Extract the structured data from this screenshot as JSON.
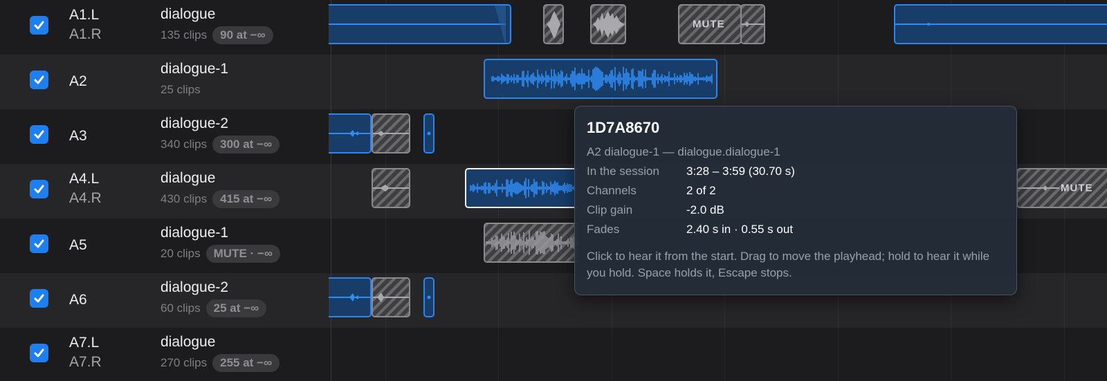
{
  "tracks": [
    {
      "channels": [
        "A1.L",
        "A1.R"
      ],
      "title": "dialogue",
      "clips": "135 clips",
      "gain": "90 at −∞"
    },
    {
      "channels": [
        "A2"
      ],
      "title": "dialogue-1",
      "clips": "25 clips",
      "gain": ""
    },
    {
      "channels": [
        "A3"
      ],
      "title": "dialogue-2",
      "clips": "340 clips",
      "gain": "300 at −∞"
    },
    {
      "channels": [
        "A4.L",
        "A4.R"
      ],
      "title": "dialogue",
      "clips": "430 clips",
      "gain": "415 at −∞"
    },
    {
      "channels": [
        "A5"
      ],
      "title": "dialogue-1",
      "clips": "20 clips",
      "gain": "MUTE · −∞"
    },
    {
      "channels": [
        "A6"
      ],
      "title": "dialogue-2",
      "clips": "60 clips",
      "gain": "25 at −∞"
    },
    {
      "channels": [
        "A7.L",
        "A7.R"
      ],
      "title": "dialogue",
      "clips": "270 clips",
      "gain": "255 at −∞"
    }
  ],
  "mute_label": "MUTE",
  "mute_label_truncated": "MUTE",
  "tooltip": {
    "title": "1D7A8670",
    "subtitle": "A2 dialogue-1  —  dialogue.dialogue-1",
    "rows": [
      {
        "label": "In the session",
        "value": "3:28 – 3:59  (30.70 s)"
      },
      {
        "label": "Channels",
        "value": "2 of 2"
      },
      {
        "label": "Clip gain",
        "value": "-2.0 dB"
      },
      {
        "label": "Fades",
        "value": "2.40 s in · 0.55 s out"
      }
    ],
    "help": "Click to hear it from the start. Drag to move the playhead; hold to hear it while you hold. Space holds it, Escape stops."
  },
  "colors": {
    "accent": "#2d86ee",
    "clip_fill": "#173d68",
    "waveform": "#2f8cf5",
    "muted_wave": "#9a9a9e"
  }
}
